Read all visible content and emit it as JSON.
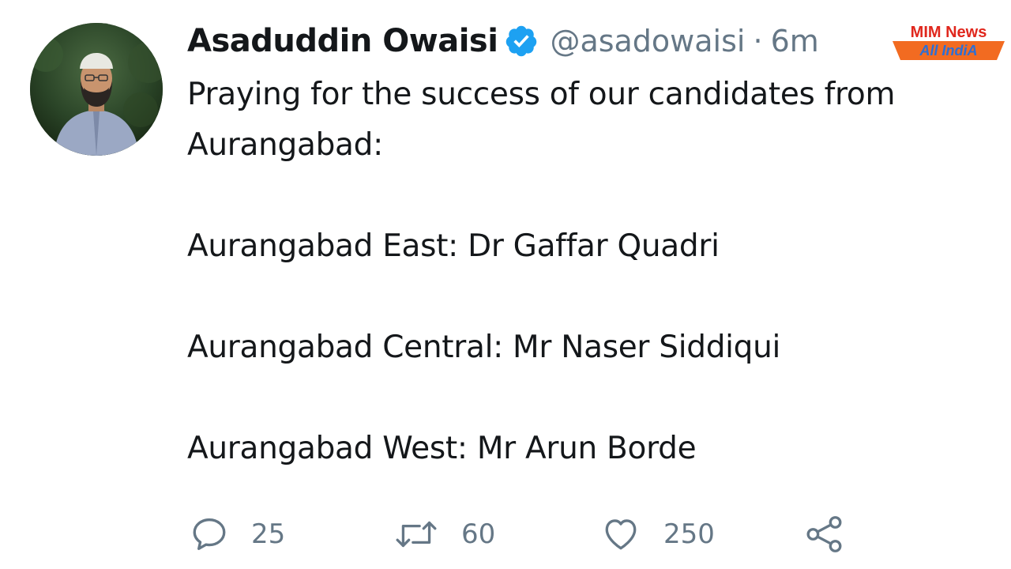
{
  "author": {
    "display_name": "Asaduddin Owaisi",
    "handle": "@asadowaisi",
    "separator": "·",
    "time": "6m",
    "verified": true,
    "avatar_icon": "profile-photo"
  },
  "tweet": {
    "line_intro_1": "Praying for the success of our candidates from",
    "line_intro_2": "Aurangabad:",
    "line_east": "Aurangabad East: Dr Gaffar Quadri",
    "line_central": "Aurangabad Central: Mr Naser Siddiqui",
    "line_west": "Aurangabad West: Mr Arun Borde"
  },
  "actions": {
    "reply_count": "25",
    "retweet_count": "60",
    "like_count": "250",
    "reply_icon": "reply-icon",
    "retweet_icon": "retweet-icon",
    "like_icon": "heart-icon",
    "share_icon": "share-icon"
  },
  "watermark": {
    "line1": "MIM News",
    "line2": "All IndiA"
  },
  "colors": {
    "text_primary": "#14171a",
    "text_secondary": "#657786",
    "verified_blue": "#1da1f2",
    "watermark_red": "#e0271d",
    "watermark_orange": "#f26b21",
    "watermark_blue": "#2b6fd6"
  }
}
